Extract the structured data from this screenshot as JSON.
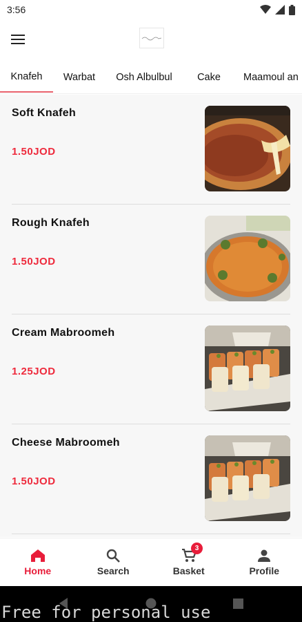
{
  "status_bar": {
    "time": "3:56"
  },
  "tabs": [
    {
      "label": "Knafeh",
      "active": true
    },
    {
      "label": "Warbat",
      "active": false
    },
    {
      "label": "Osh Albulbul",
      "active": false
    },
    {
      "label": "Cake",
      "active": false
    },
    {
      "label": "Maamoul an",
      "active": false
    }
  ],
  "items": [
    {
      "name": "Soft Knafeh",
      "price": "1.50JOD",
      "image": "soft-knafeh-photo"
    },
    {
      "name": "Rough Knafeh",
      "price": "1.50JOD",
      "image": "rough-knafeh-photo"
    },
    {
      "name": "Cream Mabroomeh",
      "price": "1.25JOD",
      "image": "cream-mabroomeh-photo"
    },
    {
      "name": "Cheese Mabroomeh",
      "price": "1.50JOD",
      "image": "cheese-mabroomeh-photo"
    }
  ],
  "bottom_nav": {
    "home": "Home",
    "search": "Search",
    "basket": "Basket",
    "basket_count": "3",
    "profile": "Profile"
  },
  "colors": {
    "accent": "#e81d3a",
    "price": "#ee2a3c",
    "tab_indicator": "#e8616c"
  },
  "watermark": "Free for personal use"
}
